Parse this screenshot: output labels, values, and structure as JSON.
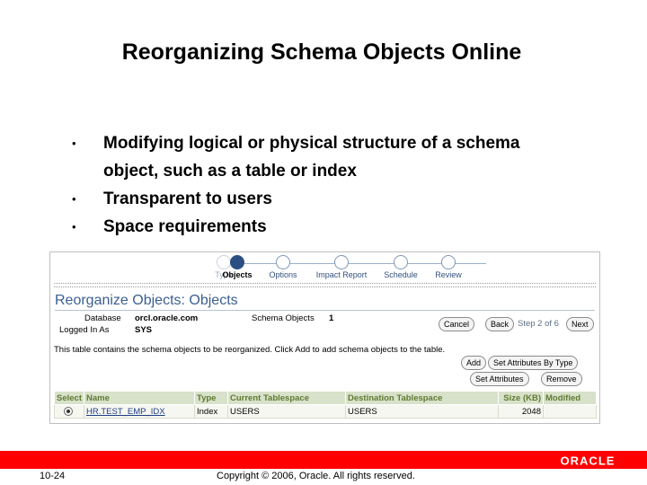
{
  "slide": {
    "title": "Reorganizing Schema Objects Online",
    "bullets": [
      "Modifying logical or physical structure of a schema object, such as a table or index",
      "Transparent to users",
      "Space requirements"
    ],
    "bullet_symbol": "•"
  },
  "screenshot": {
    "train": [
      {
        "label": "Type",
        "state": "done"
      },
      {
        "label": "Objects",
        "state": "current"
      },
      {
        "label": "Options",
        "state": "todo"
      },
      {
        "label": "Impact Report",
        "state": "todo"
      },
      {
        "label": "Schedule",
        "state": "todo"
      },
      {
        "label": "Review",
        "state": "todo"
      }
    ],
    "heading": "Reorganize Objects: Objects",
    "database_label": "Database",
    "database_value": "orcl.oracle.com",
    "logged_in_label": "Logged In As",
    "logged_in_value": "SYS",
    "schema_objects_label": "Schema Objects",
    "schema_objects_value": "1",
    "cancel_label": "Cancel",
    "back_label": "Back",
    "step_text": "Step 2 of 6",
    "next_label": "Next",
    "description": "This table contains the schema objects to be reorganized. Click Add to add schema objects to the table.",
    "add_label": "Add",
    "set_attr_by_type_label": "Set Attributes By Type",
    "set_attr_label": "Set Attributes",
    "remove_label": "Remove",
    "table": {
      "columns": [
        "Select",
        "Name",
        "Type",
        "Current Tablespace",
        "Destination Tablespace",
        "Size (KB)",
        "Modified"
      ],
      "rows": [
        {
          "name": "HR.TEST_EMP_IDX",
          "type": "Index",
          "current": "USERS",
          "destination": "USERS",
          "size": "2048",
          "modified": ""
        }
      ]
    }
  },
  "footer": {
    "page_number": "10-24",
    "copyright": "Copyright © 2006, Oracle. All rights reserved.",
    "logo_text": "ORACLE"
  },
  "colors": {
    "accent_red": "#ff0000",
    "train_blue": "#2c4f83",
    "header_green": "#d8e1c9"
  }
}
